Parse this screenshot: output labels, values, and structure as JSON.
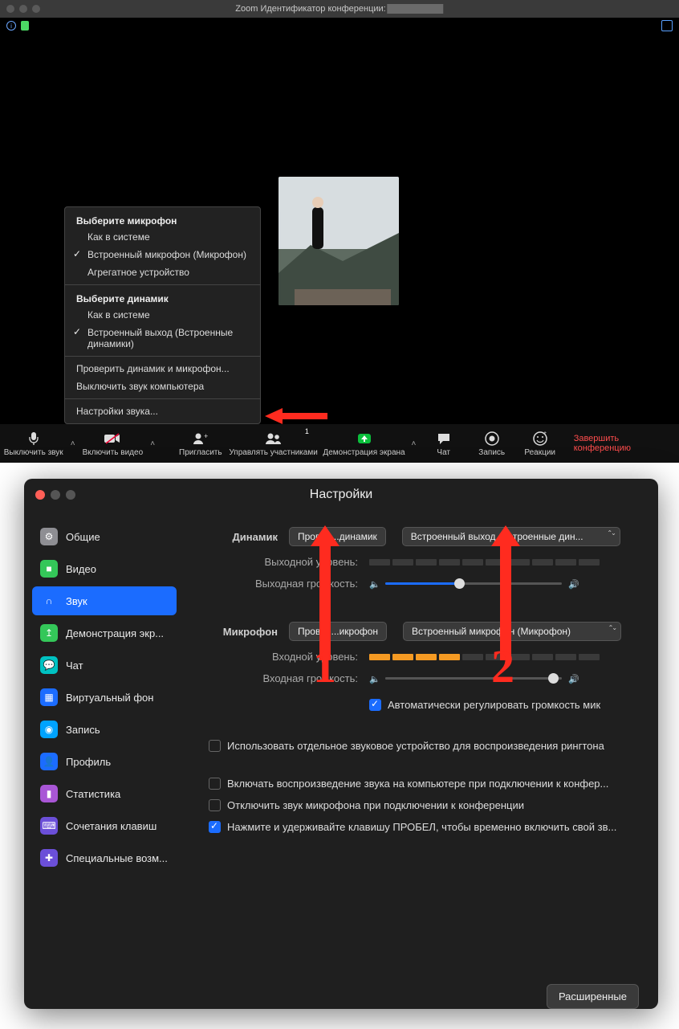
{
  "win1": {
    "title_prefix": "Zoom Идентификатор конференции:",
    "popup": {
      "mic_header": "Выберите микрофон",
      "mic_items": [
        "Как в системе",
        "Встроенный микрофон (Микрофон)",
        "Агрегатное устройство"
      ],
      "mic_selected_index": 1,
      "spk_header": "Выберите динамик",
      "spk_items": [
        "Как в системе",
        "Встроенный выход (Встроенные динамики)"
      ],
      "spk_selected_index": 1,
      "extra": [
        "Проверить динамик и микрофон...",
        "Выключить звук компьютера"
      ],
      "footer": "Настройки звука..."
    },
    "toolbar": {
      "mute": "Выключить звук",
      "video": "Включить видео",
      "invite": "Пригласить",
      "participants": "Управлять участниками",
      "participants_count": "1",
      "share": "Демонстрация экрана",
      "chat": "Чат",
      "record": "Запись",
      "reactions": "Реакции",
      "end": "Завершить конференцию"
    }
  },
  "win2": {
    "title": "Настройки",
    "sidebar": [
      {
        "label": "Общие",
        "color": "#8e8e93",
        "icon": "gear"
      },
      {
        "label": "Видео",
        "color": "#34c759",
        "icon": "video"
      },
      {
        "label": "Звук",
        "color": "#1b6cff",
        "icon": "headphones",
        "active": true
      },
      {
        "label": "Демонстрация экр...",
        "color": "#34c759",
        "icon": "share"
      },
      {
        "label": "Чат",
        "color": "#00c2c2",
        "icon": "chat"
      },
      {
        "label": "Виртуальный фон",
        "color": "#1b6cff",
        "icon": "bg"
      },
      {
        "label": "Запись",
        "color": "#00a3ff",
        "icon": "record"
      },
      {
        "label": "Профиль",
        "color": "#1b6cff",
        "icon": "profile"
      },
      {
        "label": "Статистика",
        "color": "#a956d6",
        "icon": "stats"
      },
      {
        "label": "Сочетания клавиш",
        "color": "#6b4fd8",
        "icon": "kbd"
      },
      {
        "label": "Специальные возм...",
        "color": "#6b4fd8",
        "icon": "access"
      }
    ],
    "speaker_section": {
      "label": "Динамик",
      "test_button": "Провер...динамик",
      "device": "Встроенный выход (Встроенные дин...",
      "out_level": "Выходной уровень:",
      "out_volume": "Выходная громкость:",
      "volume_pct": 42
    },
    "mic_section": {
      "label": "Микрофон",
      "test_button": "Провер...икрофон",
      "device": "Встроенный микрофон (Микрофон)",
      "in_level": "Входной уровень:",
      "in_level_segments_on": 4,
      "in_volume": "Входная громкость:",
      "volume_pct": 95,
      "auto_adjust": "Автоматически регулировать громкость мик"
    },
    "ring_checkbox": "Использовать отдельное звуковое устройство для воспроизведения рингтона",
    "opts": [
      {
        "checked": false,
        "label": "Включать воспроизведение звука на компьютере при подключении к конфер..."
      },
      {
        "checked": false,
        "label": "Отключить звук микрофона при подключении к конференции"
      },
      {
        "checked": true,
        "label": "Нажмите и удерживайте клавишу ПРОБЕЛ, чтобы временно включить свой зв..."
      }
    ],
    "advanced": "Расширенные",
    "annotations": {
      "num1": "1",
      "num2": "2"
    }
  }
}
